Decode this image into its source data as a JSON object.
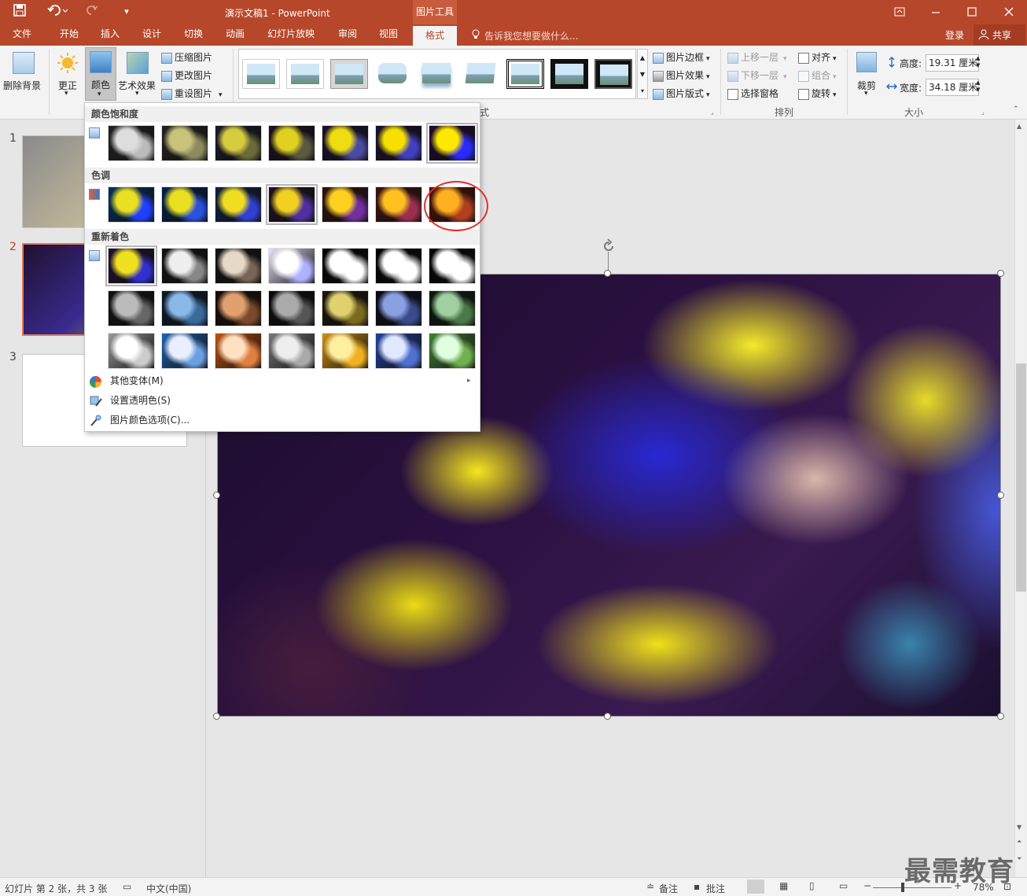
{
  "window": {
    "title": "演示文稿1 - PowerPoint",
    "context_tab_group": "图片工具",
    "min_icon": "minimize-icon",
    "max_icon": "maximize-icon",
    "close_icon": "close-icon",
    "restore_icon": "ribbon-display-icon"
  },
  "tabs": [
    {
      "label": "文件"
    },
    {
      "label": "开始"
    },
    {
      "label": "插入"
    },
    {
      "label": "设计"
    },
    {
      "label": "切换"
    },
    {
      "label": "动画"
    },
    {
      "label": "幻灯片放映"
    },
    {
      "label": "审阅"
    },
    {
      "label": "视图"
    },
    {
      "label": "格式",
      "active": true
    }
  ],
  "tellme": "告诉我您想要做什么...",
  "account": {
    "signin": "登录",
    "share": "共享"
  },
  "ribbon": {
    "remove_bg": "删除背景",
    "corrections": "更正",
    "color": "颜色",
    "artistic": "艺术效果",
    "compress": "压缩图片",
    "change": "更改图片",
    "reset": "重设图片",
    "border": "图片边框",
    "effects": "图片效果",
    "layout": "图片版式",
    "bring_forward": "上移一层",
    "send_backward": "下移一层",
    "selection_pane": "选择窗格",
    "align": "对齐",
    "group": "组合",
    "rotate": "旋转",
    "crop": "裁剪",
    "height_label": "高度:",
    "height_value": "19.31 厘米",
    "width_label": "宽度:",
    "width_value": "34.18 厘米",
    "group_styles": "式",
    "group_arrange": "排列",
    "group_size": "大小"
  },
  "dropdown": {
    "saturation": "颜色饱和度",
    "tone": "色调",
    "recolor": "重新着色",
    "more_variations": "其他变体(M)",
    "set_transparent": "设置透明色(S)",
    "color_options": "图片颜色选项(C)..."
  },
  "slides": [
    {
      "number": "1"
    },
    {
      "number": "2"
    },
    {
      "number": "3"
    }
  ],
  "status": {
    "slide_info": "幻灯片 第 2 张，共 3 张",
    "language": "中文(中国)",
    "notes": "备注",
    "comments": "批注",
    "zoom": "78%"
  },
  "watermark": "最需教育",
  "colors": {
    "accent": "#b7472a",
    "highlight_circle": "#e0312d"
  }
}
